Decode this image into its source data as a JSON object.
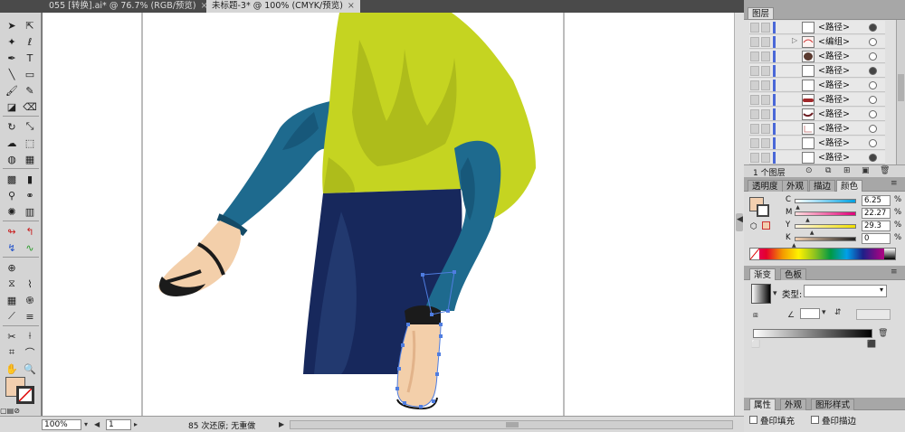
{
  "tabs": [
    {
      "label": "055 [转换].ai* @ 76.7% (RGB/预览)",
      "close": "×"
    },
    {
      "label": "未标题-3* @ 100% (CMYK/预览)",
      "close": "×"
    }
  ],
  "layers_panel": {
    "tab": "图层",
    "rows": [
      {
        "name": "<路径>",
        "target_filled": true
      },
      {
        "name": "<编组>",
        "twirl": "▷",
        "target_filled": false
      },
      {
        "name": "<路径>",
        "target_filled": false
      },
      {
        "name": "<路径>",
        "target_filled": true
      },
      {
        "name": "<路径>",
        "target_filled": false
      },
      {
        "name": "<路径>",
        "target_filled": false
      },
      {
        "name": "<路径>",
        "target_filled": false
      },
      {
        "name": "<路径>",
        "target_filled": false
      },
      {
        "name": "<路径>",
        "target_filled": false
      },
      {
        "name": "<路径>",
        "target_filled": true
      }
    ],
    "footer": "1 个图层"
  },
  "color_panel": {
    "tabs": [
      "透明度",
      "外观",
      "描边",
      "颜色"
    ],
    "channels": [
      {
        "label": "C",
        "value": "6.25",
        "unit": "%",
        "level": 0.0625
      },
      {
        "label": "M",
        "value": "22.27",
        "unit": "%",
        "level": 0.2227
      },
      {
        "label": "Y",
        "value": "29.3",
        "unit": "%",
        "level": 0.293
      },
      {
        "label": "K",
        "value": "0",
        "unit": "%",
        "level": 0
      }
    ],
    "fill_color": "#f2cfaf"
  },
  "gradient_panel": {
    "tabs": [
      "渐变",
      "色板"
    ],
    "type_label": "类型:",
    "type_value": ""
  },
  "bottom_panel": {
    "tabs": [
      "属性",
      "外观",
      "图形样式"
    ],
    "overprint_fill": "叠印填充",
    "overprint_stroke": "叠印描边"
  },
  "statusbar": {
    "zoom": "100%",
    "page": "1",
    "message": "85 次还原; 无重做"
  },
  "colors": {
    "shirt": "#c5d421",
    "shirt_shadow": "#aebc1b",
    "jeans": "#1e6a8e",
    "jeans_shadow": "#17587a",
    "pants": "#17285c",
    "pants_light": "#22396f",
    "skin": "#f3cfaa",
    "skin_shadow": "#e2b38a",
    "shoe": "#1b1b1b",
    "selection": "#4f7de0"
  }
}
